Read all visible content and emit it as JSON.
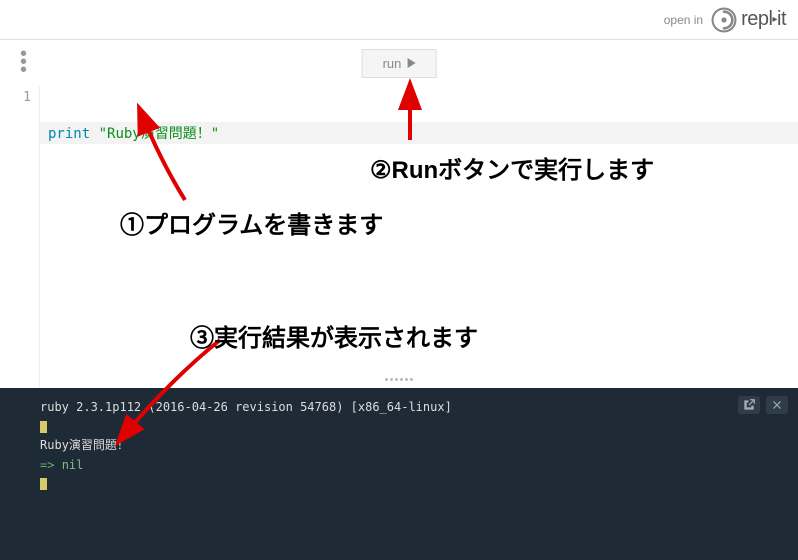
{
  "topbar": {
    "open_in": "open in",
    "brand": "repl",
    "brand_suffix": "it"
  },
  "toolbar": {
    "run_label": "run"
  },
  "editor": {
    "line_number": "1",
    "token_keyword": "print",
    "token_space": " ",
    "token_string": "\"Ruby演習問題！\""
  },
  "console": {
    "version_line": "ruby 2.3.1p112 (2016-04-26 revision 54768) [x86_64-linux]",
    "output": "Ruby演習問題！",
    "return_prefix": "=> ",
    "return_value": "nil"
  },
  "annotations": {
    "a1": "①プログラムを書きます",
    "a2": "②Runボタンで実行します",
    "a3": "③実行結果が表示されます"
  }
}
